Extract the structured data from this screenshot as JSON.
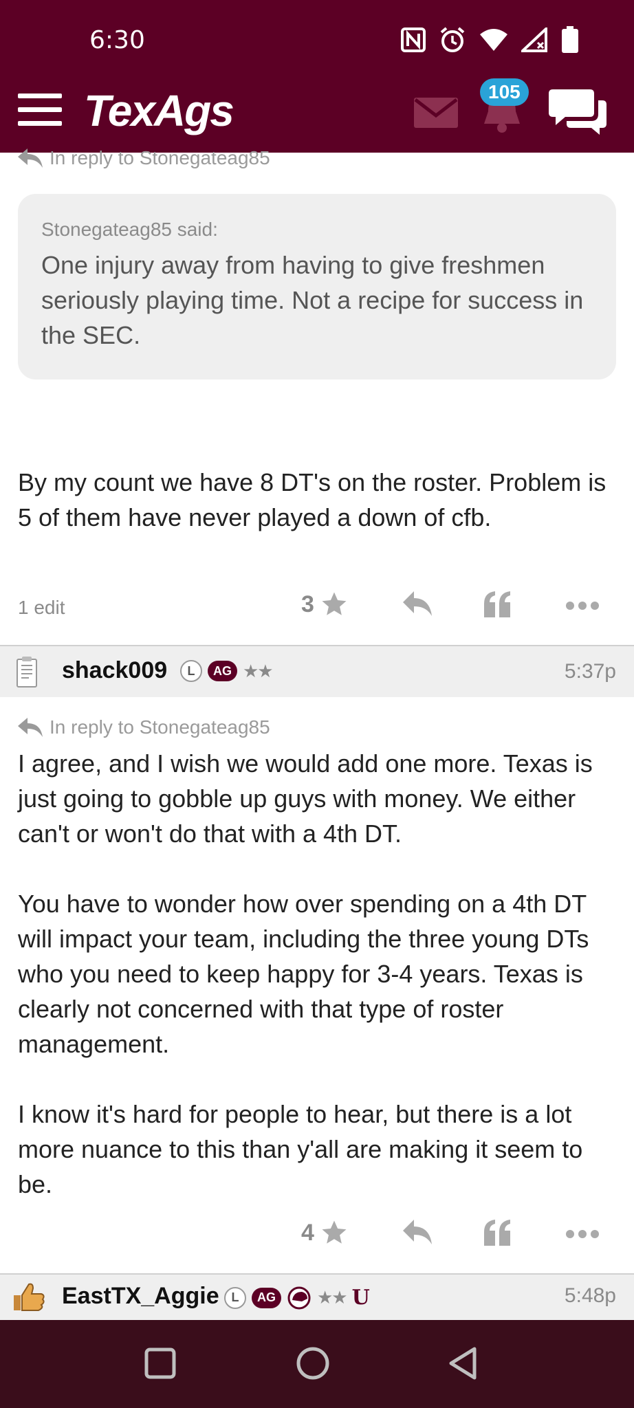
{
  "status_bar": {
    "time": "6:30"
  },
  "header": {
    "logo": "TexAgs",
    "notification_count": "105"
  },
  "post1": {
    "in_reply_to": "In reply to Stonegateag85",
    "quote_author": "Stonegateag85 said:",
    "quote_text": "One injury away from having to give freshmen seriously playing time. Not a recipe for success in the SEC.",
    "body": "By my count we have 8 DT's on the roster. Problem is 5 of them have never played a down of cfb.",
    "edit_note": "1 edit",
    "score": "3"
  },
  "post2": {
    "username": "shack009",
    "badge_l": "L",
    "badge_ag": "AG",
    "stars": "★★",
    "time": "5:37p",
    "in_reply_to": "In reply to Stonegateag85",
    "paragraphs": [
      "I agree, and I wish we would add one more. Texas is just going to gobble up guys with money. We either can't or won't do that with a 4th DT.",
      "You have to wonder how over spending on a 4th DT will impact your team, including the three young DTs who you need to keep happy for 3-4 years. Texas is clearly not concerned with that type of roster management.",
      "I know it's hard for people to hear, but there is a lot more nuance to this than y'all are making it seem to be."
    ],
    "score": "4"
  },
  "post3": {
    "username": "EastTX_Aggie",
    "badge_l": "L",
    "badge_ag": "AG",
    "stars": "★★",
    "u_badge": "U",
    "time": "5:48p"
  },
  "icons": {
    "status": [
      "nfc-icon",
      "alarm-icon",
      "wifi-icon",
      "signal-icon",
      "battery-icon"
    ],
    "header": [
      "menu-icon",
      "mail-icon",
      "bell-icon",
      "chat-icon"
    ],
    "post_actions": [
      "star-icon",
      "reply-icon",
      "quote-icon",
      "more-icon"
    ],
    "navbar": [
      "recents-icon",
      "home-icon",
      "back-icon"
    ]
  },
  "colors": {
    "brand": "#5c0025",
    "badge": "#2aa3d8",
    "navbar": "#3a0d1b"
  }
}
